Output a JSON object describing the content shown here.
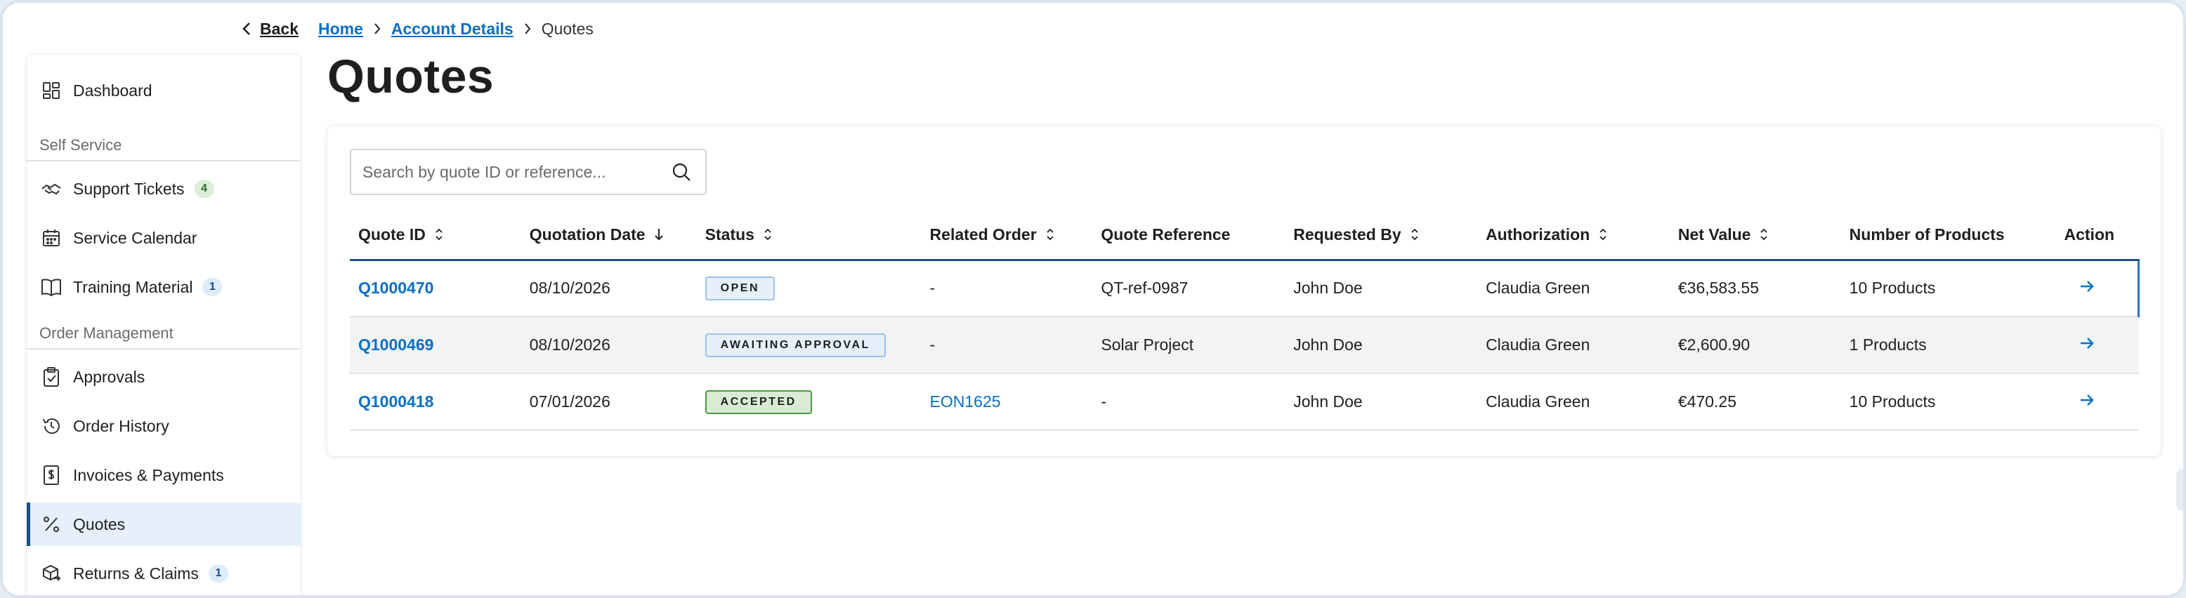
{
  "breadcrumb": {
    "back_label": "Back",
    "items": [
      "Home",
      "Account Details"
    ],
    "current": "Quotes"
  },
  "sidebar": {
    "dashboard": "Dashboard",
    "section_self_service": "Self Service",
    "support_tickets": "Support Tickets",
    "support_tickets_badge": "4",
    "service_calendar": "Service Calendar",
    "training_material": "Training Material",
    "training_material_badge": "1",
    "section_order_management": "Order Management",
    "approvals": "Approvals",
    "order_history": "Order History",
    "invoices_payments": "Invoices & Payments",
    "quotes": "Quotes",
    "returns_claims": "Returns & Claims",
    "returns_claims_badge": "1"
  },
  "page": {
    "title": "Quotes"
  },
  "search": {
    "placeholder": "Search by quote ID or reference..."
  },
  "table": {
    "headers": {
      "quote_id": "Quote ID",
      "quotation_date": "Quotation Date",
      "status": "Status",
      "related_order": "Related Order",
      "quote_reference": "Quote Reference",
      "requested_by": "Requested By",
      "authorization": "Authorization",
      "net_value": "Net Value",
      "number_of_products": "Number of Products",
      "action": "Action"
    },
    "rows": [
      {
        "quote_id": "Q1000470",
        "date": "08/10/2026",
        "status": "OPEN",
        "related_order": "-",
        "reference": "QT-ref-0987",
        "requested_by": "John Doe",
        "authorization": "Claudia Green",
        "net_value": "€36,583.55",
        "products": "10 Products"
      },
      {
        "quote_id": "Q1000469",
        "date": "08/10/2026",
        "status": "AWAITING APPROVAL",
        "related_order": "-",
        "reference": "Solar Project",
        "requested_by": "John Doe",
        "authorization": "Claudia Green",
        "net_value": "€2,600.90",
        "products": "1 Products"
      },
      {
        "quote_id": "Q1000418",
        "date": "07/01/2026",
        "status": "ACCEPTED",
        "related_order": "EON1625",
        "reference": "-",
        "requested_by": "John Doe",
        "authorization": "Claudia Green",
        "net_value": "€470.25",
        "products": "10 Products"
      }
    ]
  },
  "colors": {
    "link": "#0b6fc6",
    "active_nav_bg": "#e5f0fb",
    "active_nav_border": "#1d4e89",
    "accepted_bg": "#d8ecd3",
    "open_bg": "#e5f0fb"
  }
}
